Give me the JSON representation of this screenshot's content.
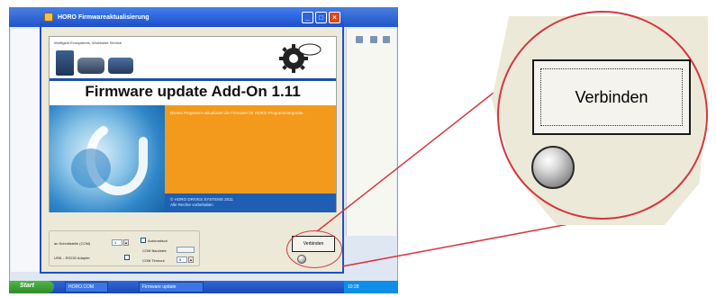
{
  "background_app": {
    "taskbar": {
      "start_label": "Start",
      "items": [
        "HORO.COM",
        "Firmware update"
      ],
      "tray_time": "10:28"
    }
  },
  "dialog": {
    "title": "HORO Firmwareaktualisierung",
    "company_line": "Intelligent Ecosystems, Worldwide Service",
    "headline": "Firmware update Add-On 1.11",
    "orange_text": "Dieses Programm aktualisiert die Firmware für HORO-Programmiergeräte.",
    "blue_text": "© HORO DRIVES SYSTEMS 2011\nAlle Rechte vorbehalten",
    "settings": {
      "port_label": "an Schnittstelle (COM)",
      "port_value": "1",
      "device_label": "USB – RS232 Adapter",
      "autodetect_label": "Automatisch",
      "baud_label": "COM Baudrate",
      "timeout_label": "COM Timeout",
      "timeout_value": "5"
    },
    "connect_button_label": "Verbinden"
  },
  "zoom": {
    "button_label": "Verbinden"
  },
  "colors": {
    "callout_red": "#d8353d",
    "titlebar_blue": "#1c4ec7",
    "orange_panel": "#f39a1c",
    "blue_panel": "#1f5fb3"
  }
}
